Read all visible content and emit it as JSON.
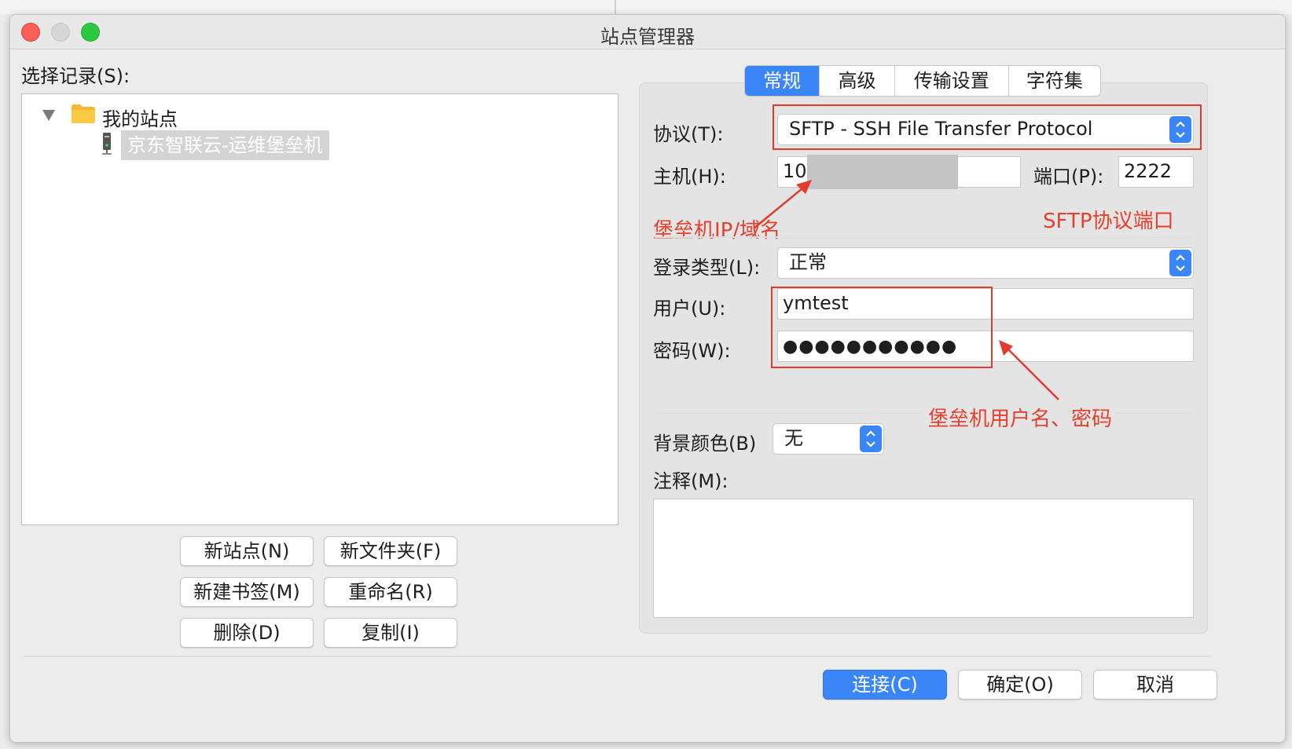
{
  "window": {
    "title": "站点管理器"
  },
  "left": {
    "select_label": "选择记录(S):",
    "tree": {
      "folder_label": "我的站点",
      "site_label": "京东智联云-运维堡垒机"
    },
    "buttons": {
      "new_site": "新站点(N)",
      "new_folder": "新文件夹(F)",
      "new_bookmark": "新建书签(M)",
      "rename": "重命名(R)",
      "delete": "删除(D)",
      "copy": "复制(I)"
    }
  },
  "tabs": [
    "常规",
    "高级",
    "传输设置",
    "字符集"
  ],
  "active_tab": "常规",
  "form": {
    "protocol_label": "协议(T):",
    "protocol_value": "SFTP - SSH File Transfer Protocol",
    "host_label": "主机(H):",
    "host_value": "10.",
    "port_label": "端口(P):",
    "port_value": "2222",
    "logon_type_label": "登录类型(L):",
    "logon_type_value": "正常",
    "user_label": "用户(U):",
    "user_value": "ymtest",
    "password_label": "密码(W):",
    "password_value": "●●●●●●●●●●●",
    "bg_color_label": "背景颜色(B)",
    "bg_color_value": "无",
    "comments_label": "注释(M):"
  },
  "annotations": {
    "host": "堡垒机IP/域名",
    "port": "SFTP协议端口",
    "credentials": "堡垒机用户名、密码"
  },
  "footer": {
    "connect": "连接(C)",
    "ok": "确定(O)",
    "cancel": "取消"
  },
  "colors": {
    "accent": "#3a85f7",
    "annotation_red": "#e23b2b",
    "close": "#fc5f57",
    "minimize_inactive": "#d6d6d6",
    "zoom": "#2ac940"
  }
}
